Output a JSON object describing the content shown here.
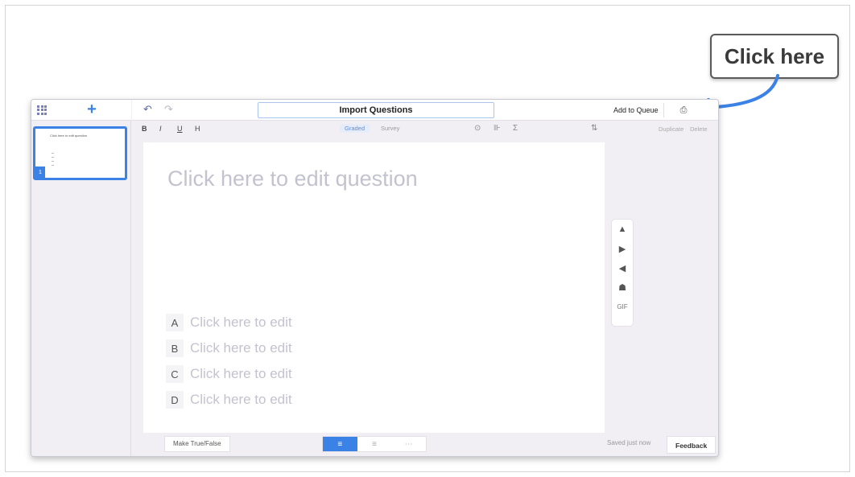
{
  "callout": {
    "text": "Click here"
  },
  "sidebar": {
    "add_icon": "+",
    "slide": {
      "number": "1",
      "title": "Click here to edit question"
    }
  },
  "topbar": {
    "undo_icon": "↶",
    "redo_icon": "↷",
    "title_value": "Import Questions",
    "add_to_queue": "Add to Queue",
    "import_icon": "⎙"
  },
  "format": {
    "bold": "B",
    "italic": "I",
    "underline": "U",
    "heading": "H",
    "graded": "Graded",
    "survey": "Survey",
    "points_icon": "⊙",
    "style_icon": "⊪",
    "math_icon": "Σ",
    "sort_icon": "⇅",
    "duplicate": "Duplicate",
    "delete": "Delete"
  },
  "question": {
    "placeholder": "Click here to edit question",
    "answers": [
      {
        "letter": "A",
        "text": "Click here to edit"
      },
      {
        "letter": "B",
        "text": "Click here to edit"
      },
      {
        "letter": "C",
        "text": "Click here to edit"
      },
      {
        "letter": "D",
        "text": "Click here to edit"
      }
    ]
  },
  "media": {
    "image_icon": "▲",
    "video_icon": "▶",
    "audio_icon": "◀",
    "web_icon": "☗",
    "gif": "GIF"
  },
  "bottom": {
    "make_true_false": "Make True/False",
    "layout_icons": [
      "≡",
      "≡",
      "⋯"
    ],
    "saved": "Saved just now",
    "feedback": "Feedback"
  },
  "colors": {
    "accent": "#3b82e6",
    "panel_bg": "#f1eef4"
  }
}
